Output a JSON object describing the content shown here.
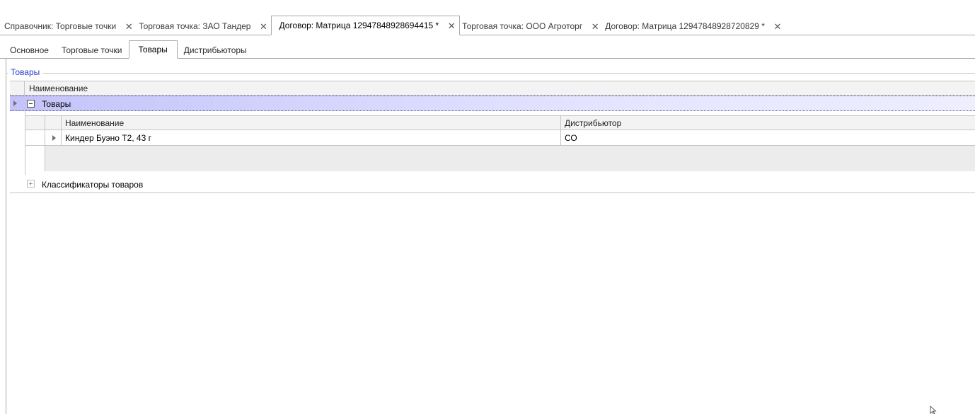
{
  "document_tabs": [
    {
      "label": "Справочник: Торговые точки",
      "active": false
    },
    {
      "label": "Торговая точка: ЗАО Тандер",
      "active": false
    },
    {
      "label": "Договор: Матрица 1294784892869441​5 *",
      "active": true
    },
    {
      "label": "Торговая точка: ООО Агроторг",
      "active": false
    },
    {
      "label": "Договор: Матрица 12947848928720829 *",
      "active": false
    }
  ],
  "close_glyph": "✕",
  "page_tabs": [
    {
      "label": "Основное",
      "active": false
    },
    {
      "label": "Торговые точки",
      "active": false
    },
    {
      "label": "Товары",
      "active": true
    },
    {
      "label": "Дистрибьюторы",
      "active": false
    }
  ],
  "group_box": {
    "caption": "Товары",
    "caption_color": "#1f3bd0"
  },
  "master_grid": {
    "column_header": "Наименование",
    "groups": [
      {
        "label": "Товары",
        "expanded": true
      },
      {
        "label": "Классификаторы товаров",
        "expanded": false
      }
    ]
  },
  "detail_grid": {
    "columns": [
      "Наименование",
      "Дистрибьютор"
    ],
    "rows": [
      {
        "name": "Киндер Буэно Т2, 43 г",
        "distributor": "СО"
      }
    ]
  },
  "colors": {
    "group_row_highlight": "#c3c3fa",
    "border": "#a9a9a9"
  }
}
